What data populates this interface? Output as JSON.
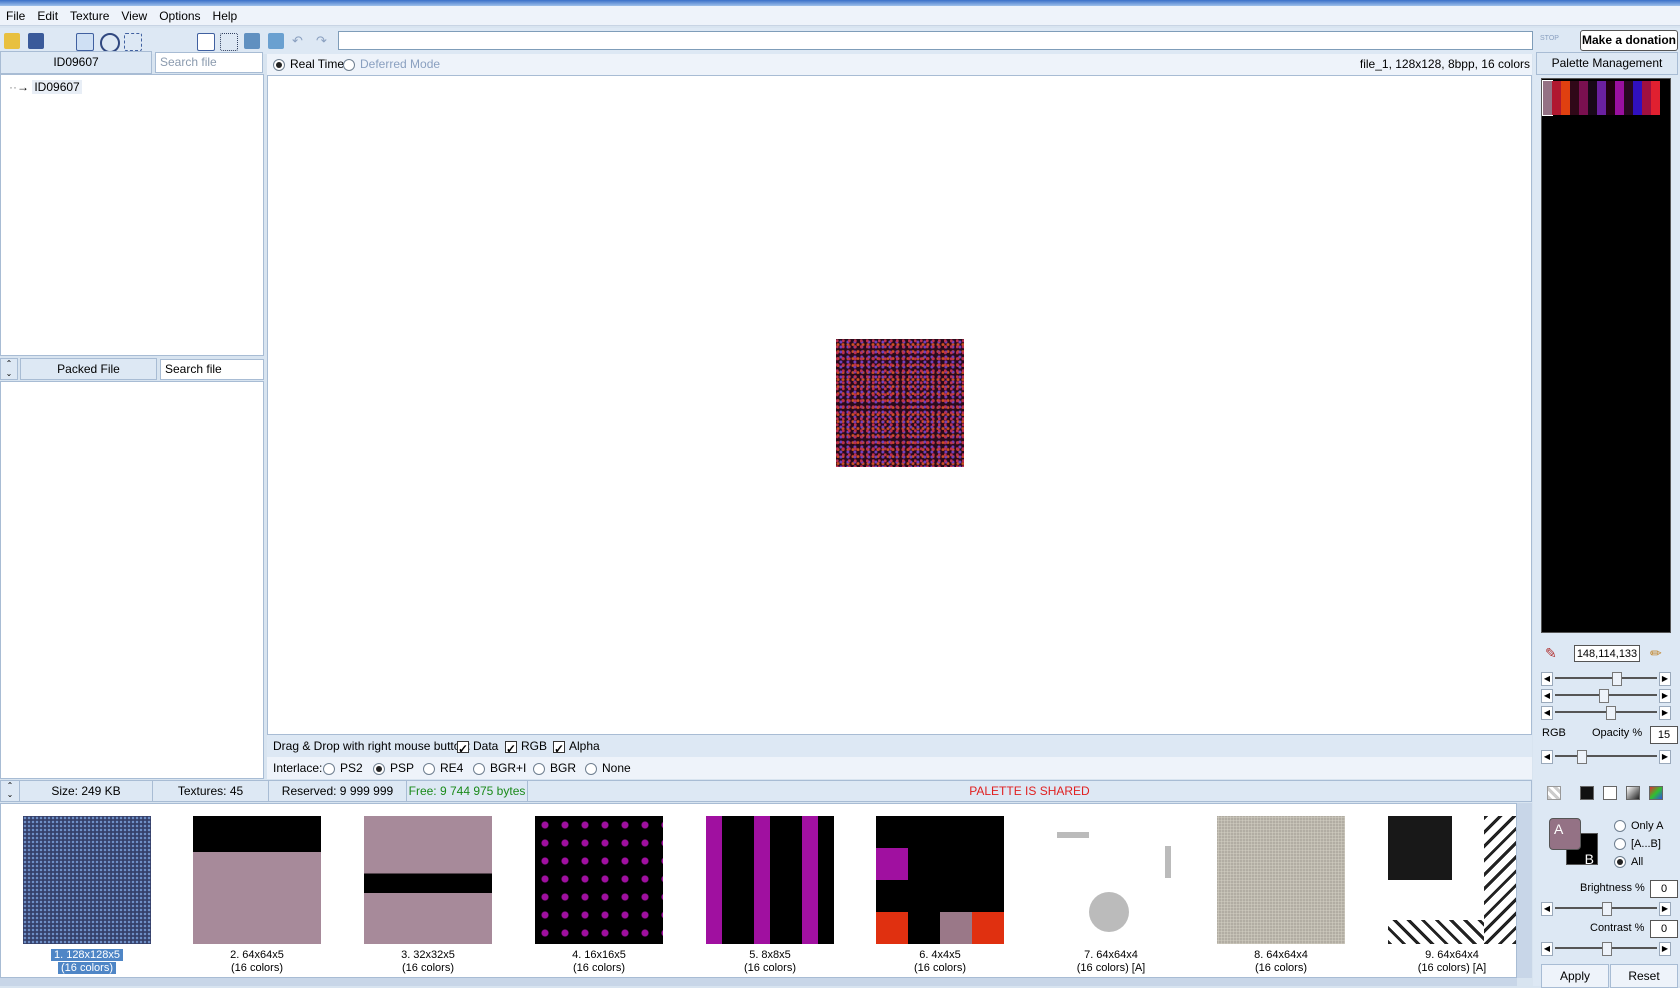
{
  "menu": [
    "File",
    "Edit",
    "Texture",
    "View",
    "Options",
    "Help"
  ],
  "toolbar": {
    "stop_label": "STOP",
    "donate_label": "Make a donation"
  },
  "tree_panel": {
    "header": "ID09607",
    "search_placeholder": "Search file",
    "root_item": "ID09607"
  },
  "packed_panel": {
    "header": "Packed File",
    "search_value": "Search file"
  },
  "viewer": {
    "mode_realtime": "Real Time",
    "mode_deferred": "Deferred Mode",
    "file_info": "file_1, 128x128, 8bpp, 16 colors",
    "dragdrop_label": "Drag & Drop with right mouse button:",
    "dd_data": "Data",
    "dd_rgb": "RGB",
    "dd_alpha": "Alpha",
    "interlace_label": "Interlace:",
    "interlace_options": [
      "PS2",
      "PSP",
      "RE4",
      "BGR+I",
      "BGR",
      "None"
    ],
    "interlace_selected": "PSP"
  },
  "status": {
    "size": "Size: 249 KB",
    "textures": "Textures: 45",
    "reserved": "Reserved: 9 999 999 bytes",
    "free": "Free: 9 744 975 bytes",
    "palette_shared": "PALETTE IS SHARED",
    "free_color": "#1a8a1a",
    "shared_color": "#e02020"
  },
  "thumbnails": [
    {
      "name": "1. 128x128x5",
      "sub": "(16 colors)",
      "selected": true
    },
    {
      "name": "2. 64x64x5",
      "sub": "(16 colors)"
    },
    {
      "name": "3. 32x32x5",
      "sub": "(16 colors)"
    },
    {
      "name": "4. 16x16x5",
      "sub": "(16 colors)"
    },
    {
      "name": "5. 8x8x5",
      "sub": "(16 colors)"
    },
    {
      "name": "6. 4x4x5",
      "sub": "(16 colors)"
    },
    {
      "name": "7. 64x64x4",
      "sub": "(16 colors) [A]"
    },
    {
      "name": "8. 64x64x4",
      "sub": "(16 colors)"
    },
    {
      "name": "9. 64x64x4",
      "sub": "(16 colors) [A]"
    }
  ],
  "palette_panel": {
    "header": "Palette Management",
    "rgb_value": "148,114,133",
    "rgb_label": "RGB",
    "opacity_label": "Opacity %",
    "opacity_value": "15",
    "swatch_a": "A",
    "swatch_b": "B",
    "mode_only_a": "Only A",
    "mode_range": "[A...B]",
    "mode_all": "All",
    "brightness_label": "Brightness %",
    "brightness_value": "0",
    "contrast_label": "Contrast %",
    "contrast_value": "0",
    "apply_label": "Apply",
    "reset_label": "Reset",
    "palette_colors": [
      "#947285",
      "#b01830",
      "#e04010",
      "#300818",
      "#7a1050",
      "#180818",
      "#6a20a0",
      "#200010",
      "#9a10a0",
      "#280820",
      "#3010c0",
      "#a01040",
      "#e02030"
    ]
  }
}
